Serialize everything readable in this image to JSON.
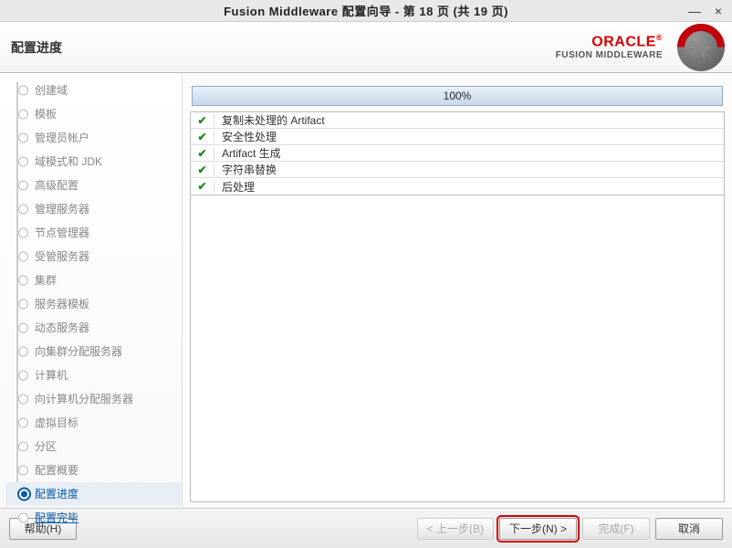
{
  "window": {
    "title": "Fusion Middleware 配置向导 - 第 18 页 (共 19 页)"
  },
  "header": {
    "title": "配置进度",
    "brand_line1": "ORACLE",
    "brand_line2": "FUSION MIDDLEWARE"
  },
  "sidebar": {
    "items": [
      {
        "label": "创建域",
        "state": "done"
      },
      {
        "label": "模板",
        "state": "done"
      },
      {
        "label": "管理员帐户",
        "state": "done"
      },
      {
        "label": "域模式和 JDK",
        "state": "done"
      },
      {
        "label": "高级配置",
        "state": "done"
      },
      {
        "label": "管理服务器",
        "state": "done"
      },
      {
        "label": "节点管理器",
        "state": "done"
      },
      {
        "label": "受管服务器",
        "state": "done"
      },
      {
        "label": "集群",
        "state": "done"
      },
      {
        "label": "服务器模板",
        "state": "done"
      },
      {
        "label": "动态服务器",
        "state": "done"
      },
      {
        "label": "向集群分配服务器",
        "state": "done"
      },
      {
        "label": "计算机",
        "state": "done"
      },
      {
        "label": "向计算机分配服务器",
        "state": "done"
      },
      {
        "label": "虚拟目标",
        "state": "done"
      },
      {
        "label": "分区",
        "state": "done"
      },
      {
        "label": "配置概要",
        "state": "done"
      },
      {
        "label": "配置进度",
        "state": "current"
      },
      {
        "label": "配置完毕",
        "state": "upcoming"
      }
    ]
  },
  "progress": {
    "percent_text": "100%",
    "tasks": [
      {
        "status": "ok",
        "label": "复制未处理的 Artifact"
      },
      {
        "status": "ok",
        "label": "安全性处理"
      },
      {
        "status": "ok",
        "label": "Artifact 生成"
      },
      {
        "status": "ok",
        "label": "字符串替换"
      },
      {
        "status": "ok",
        "label": "后处理"
      }
    ]
  },
  "footer": {
    "help": "帮助(H)",
    "back": "< 上一步(B)",
    "next": "下一步(N) >",
    "finish": "完成(F)",
    "cancel": "取消"
  }
}
